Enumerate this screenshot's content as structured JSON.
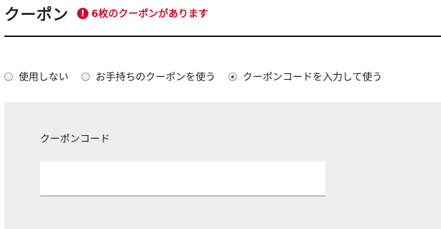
{
  "header": {
    "title": "クーポン",
    "notice_icon": "!",
    "notice_text": "6枚のクーポンがあります",
    "notice_color": "#c8102e"
  },
  "options": [
    {
      "label": "使用しない",
      "checked": false
    },
    {
      "label": "お手持ちのクーポンを使う",
      "checked": false
    },
    {
      "label": "クーポンコードを入力して使う",
      "checked": true
    }
  ],
  "coupon_code": {
    "label": "クーポンコード",
    "value": "",
    "placeholder": ""
  }
}
